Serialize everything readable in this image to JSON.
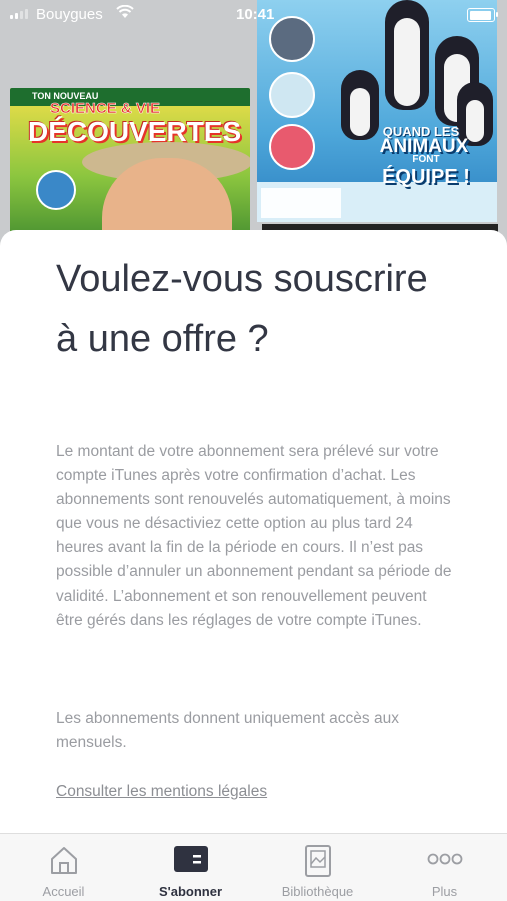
{
  "status_bar": {
    "carrier": "Bouygues",
    "time": "10:41"
  },
  "covers": {
    "cover1": {
      "kicker": "TON NOUVEAU",
      "brand": "SCIENCE & VIE",
      "title": "DÉCOUVERTES"
    },
    "cover2": {
      "headline_1": "QUAND LES",
      "headline_2": "ANIMAUX",
      "headline_3": "FONT",
      "headline_4": "ÉQUIPE !"
    }
  },
  "sheet": {
    "title": "Voulez-vous souscrire à une offre ?",
    "paragraph_1": "Le montant de votre abonnement sera prélevé sur votre compte iTunes après votre confirmation d’achat. Les abonnements sont renouvelés automatiquement, à moins que vous ne désactiviez cette option au plus tard 24 heures avant la fin de la période en cours. Il n’est pas possible d’annuler un abonnement pendant sa période de validité. L’abonnement et son renouvellement peuvent être gérés dans les réglages de votre compte iTunes.",
    "paragraph_2": "Les abonnements donnent uniquement accès aux mensuels.",
    "legal_link": "Consulter les mentions légales"
  },
  "tab_bar": {
    "active_tab": "S'abonner",
    "tabs": [
      {
        "label": "Accueil",
        "icon": "home-icon"
      },
      {
        "label": "S'abonner",
        "icon": "subscribe-icon"
      },
      {
        "label": "Bibliothèque",
        "icon": "library-icon"
      },
      {
        "label": "Plus",
        "icon": "more-icon"
      }
    ]
  },
  "colors": {
    "title_text": "#333744",
    "body_text": "#9a9ca1",
    "active_tab": "#2f3240",
    "inactive_tab": "#9c9ea3"
  }
}
